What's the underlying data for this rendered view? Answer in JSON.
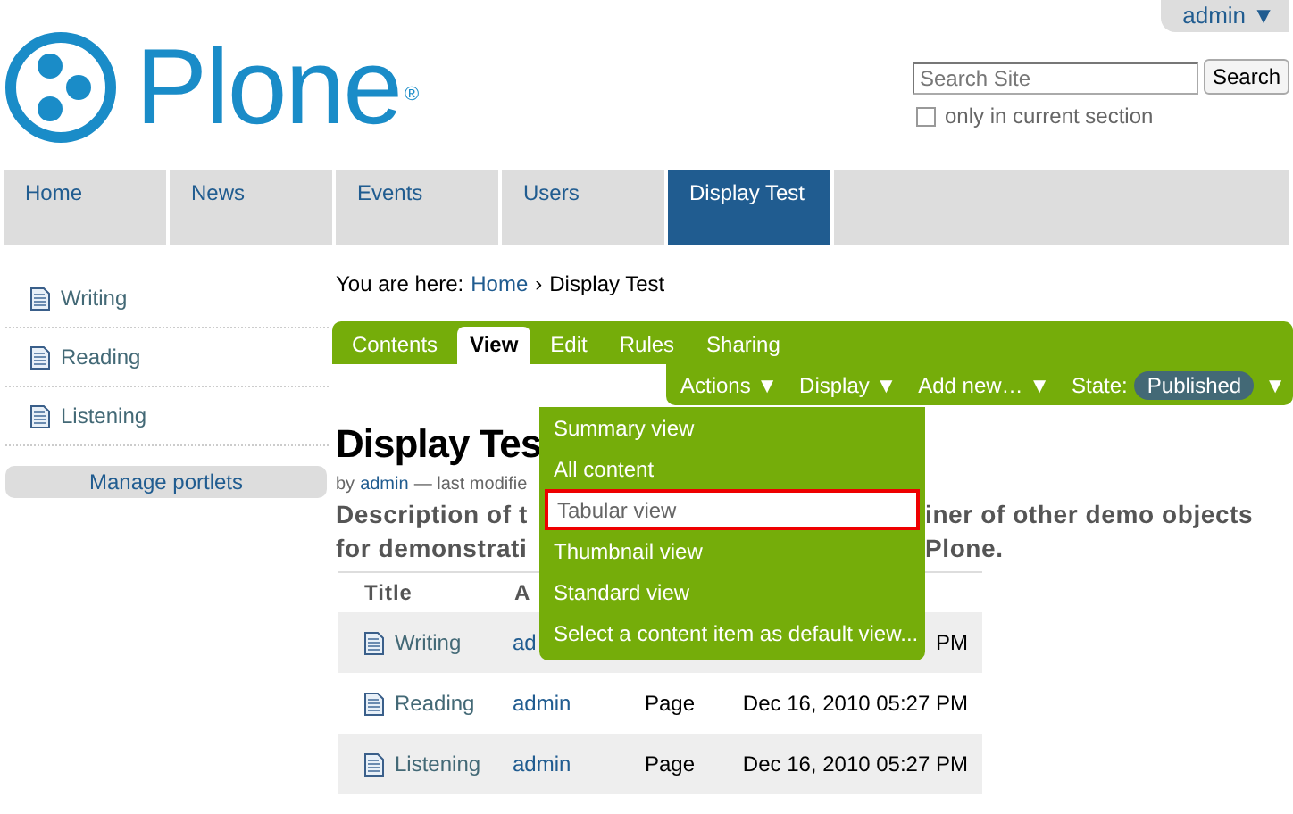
{
  "user_menu": {
    "label": "admin ▼"
  },
  "logo": {
    "text": "Plone$^{®}$"
  },
  "search": {
    "placeholder": "Search Site",
    "button": "Search",
    "scope": {
      "label": "only in current section",
      "checked": false
    }
  },
  "nav": [
    {
      "label": "Home",
      "selected": false
    },
    {
      "label": "News",
      "selected": false
    },
    {
      "label": "Events",
      "selected": false
    },
    {
      "label": "Users",
      "selected": false
    },
    {
      "label": "Display Test",
      "selected": true
    }
  ],
  "portlet": {
    "items": [
      "Writing",
      "Reading",
      "Listening"
    ],
    "manage": "Manage portlets"
  },
  "breadcrumb": {
    "prefix": "You are here:",
    "link": "Home",
    "separator": "›",
    "current": "Display Test"
  },
  "content_tabs": [
    {
      "label": "Contents",
      "selected": false
    },
    {
      "label": "View",
      "selected": true
    },
    {
      "label": "Edit",
      "selected": false
    },
    {
      "label": "Rules",
      "selected": false
    },
    {
      "label": "Sharing",
      "selected": false
    }
  ],
  "actions": [
    "Actions ▼",
    "Display ▼",
    "Add new… ▼"
  ],
  "state": {
    "label": "State:",
    "value": "Published",
    "caret": "▼"
  },
  "display_menu": [
    {
      "label": "Summary view",
      "selected": false
    },
    {
      "label": "All content",
      "selected": false
    },
    {
      "label": "Tabular view",
      "selected": true
    },
    {
      "label": "Thumbnail view",
      "selected": false
    },
    {
      "label": "Standard view",
      "selected": false
    },
    {
      "label": "Select a content item as default view...",
      "selected": false
    }
  ],
  "document": {
    "title": "Display Tes",
    "byline": {
      "prefix": "by",
      "author": "admin",
      "suffix": "— last modifie"
    },
    "description": [
      {
        "left": "Description of t",
        "right": "iner of other demo objects"
      },
      {
        "left": "for demonstrati",
        "right": "Plone."
      }
    ]
  },
  "table": {
    "columns": [
      "Title",
      "A"
    ],
    "rows": [
      {
        "title": "Writing",
        "author": "ad",
        "column_4": "PM"
      },
      {
        "title": "Reading",
        "author": "admin",
        "column_3": "Page",
        "column_4": "Dec 16, 2010 05:27 PM"
      },
      {
        "title": "Listening",
        "author": "admin",
        "column_3": "Page",
        "column_4": "Dec 16, 2010 05:27 PM"
      }
    ]
  }
}
